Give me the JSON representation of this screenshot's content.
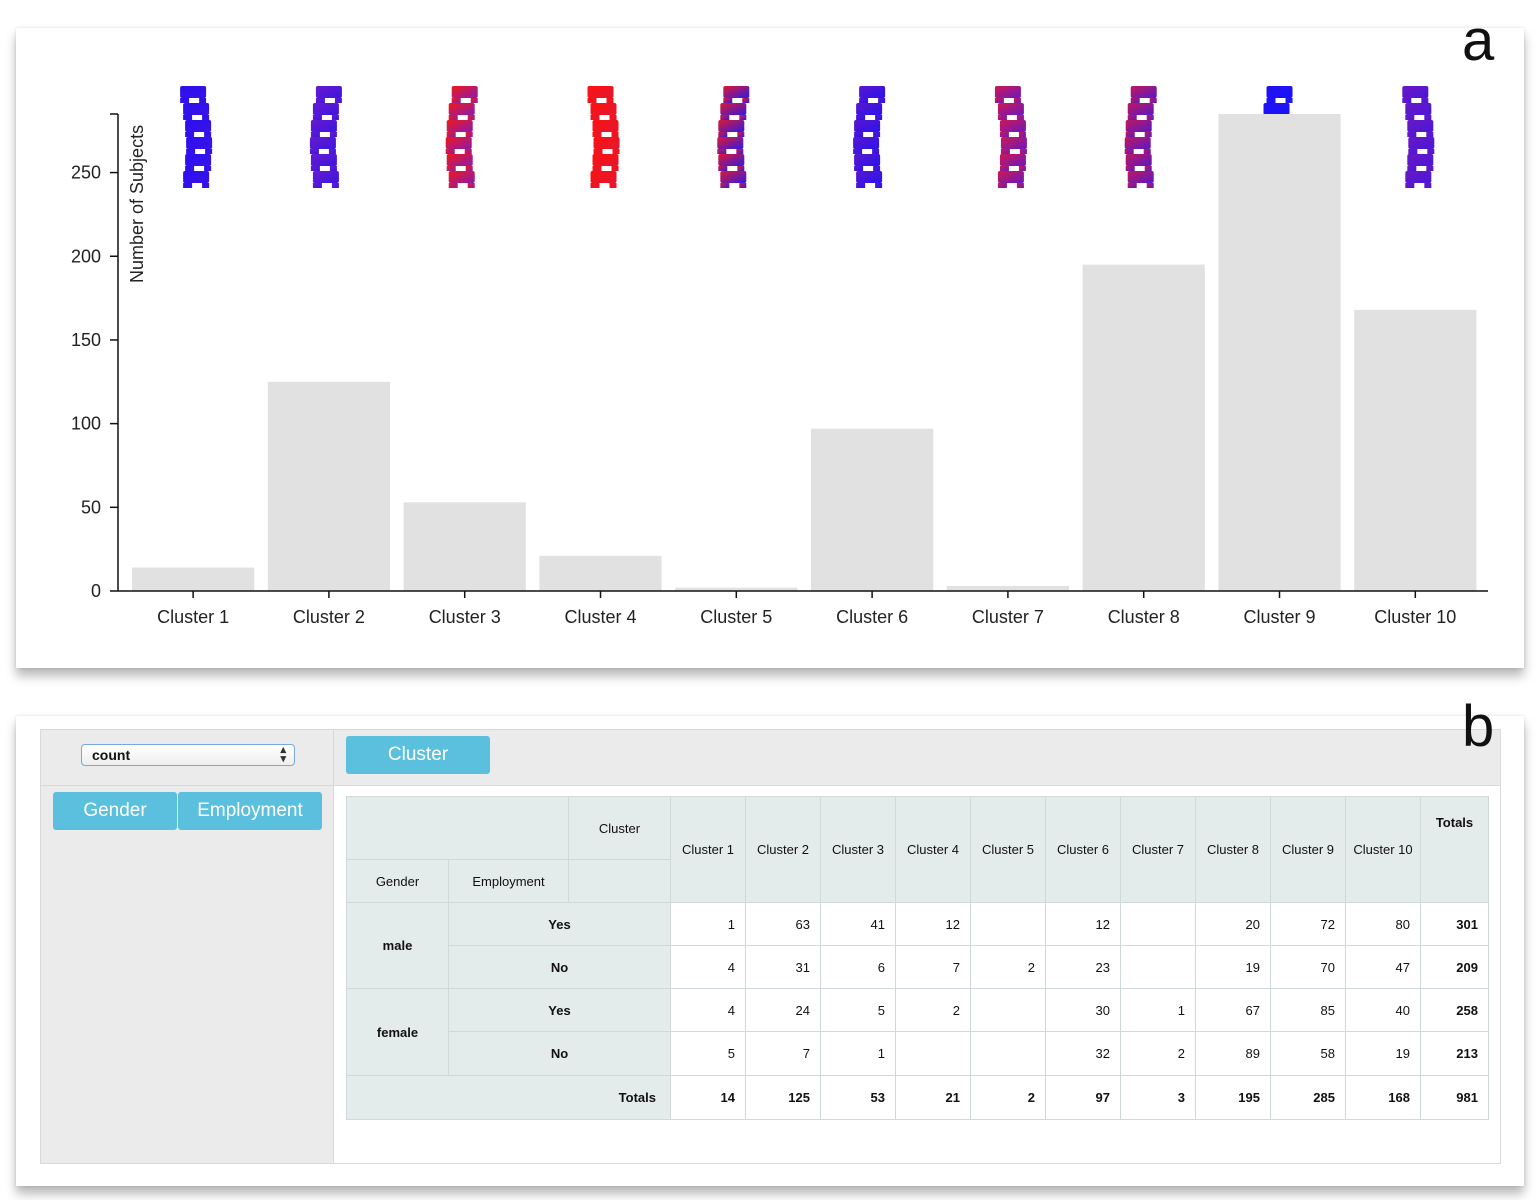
{
  "panel_a": {
    "letter": "a"
  },
  "panel_b": {
    "letter": "b"
  },
  "chart_data": {
    "type": "bar",
    "title": "",
    "xlabel": "",
    "ylabel": "Number of Subjects",
    "ylim": [
      0,
      285
    ],
    "yticks": [
      "0",
      "50",
      "100",
      "150",
      "200",
      "250"
    ],
    "categories": [
      "Cluster 1",
      "Cluster 2",
      "Cluster 3",
      "Cluster 4",
      "Cluster 5",
      "Cluster 6",
      "Cluster 7",
      "Cluster 8",
      "Cluster 9",
      "Cluster 10"
    ],
    "values": [
      14,
      125,
      53,
      21,
      2,
      97,
      3,
      195,
      285,
      168
    ],
    "bar_color": "#e1e1e1",
    "glyph_colors": [
      [
        "#2a10f0",
        "#3a12e8"
      ],
      [
        "#6a1acc",
        "#3a16e2"
      ],
      [
        "#f01818",
        "#8a1ab0"
      ],
      [
        "#ff1010",
        "#e01830"
      ],
      [
        "#e01830",
        "#3018e6"
      ],
      [
        "#5a16cc",
        "#2a14ee"
      ],
      [
        "#d01850",
        "#6a18c0"
      ],
      [
        "#c0185a",
        "#5a18c8"
      ],
      [
        "#2214f0",
        "#1a10ff"
      ],
      [
        "#6a18c4",
        "#4a16d8"
      ]
    ],
    "grid": false,
    "legend": "none"
  },
  "pivot": {
    "aggregator": "count",
    "row_fields": [
      "Gender",
      "Employment"
    ],
    "col_field": "Cluster",
    "header": {
      "col_attr_label": "Cluster",
      "row_attr_labels": [
        "Gender",
        "Employment"
      ],
      "col_labels": [
        "Cluster 1",
        "Cluster 2",
        "Cluster 3",
        "Cluster 4",
        "Cluster 5",
        "Cluster 6",
        "Cluster 7",
        "Cluster 8",
        "Cluster 9",
        "Cluster 10"
      ],
      "totals_label": "Totals"
    },
    "rows": [
      {
        "gender": "male",
        "employment": "Yes",
        "values": [
          "1",
          "63",
          "41",
          "12",
          "",
          "12",
          "",
          "20",
          "72",
          "80"
        ],
        "total": "301"
      },
      {
        "gender": "",
        "employment": "No",
        "values": [
          "4",
          "31",
          "6",
          "7",
          "2",
          "23",
          "",
          "19",
          "70",
          "47"
        ],
        "total": "209"
      },
      {
        "gender": "female",
        "employment": "Yes",
        "values": [
          "4",
          "24",
          "5",
          "2",
          "",
          "30",
          "1",
          "67",
          "85",
          "40"
        ],
        "total": "258"
      },
      {
        "gender": "",
        "employment": "No",
        "values": [
          "5",
          "7",
          "1",
          "",
          "",
          "32",
          "2",
          "89",
          "58",
          "19"
        ],
        "total": "213"
      }
    ],
    "totals_row": {
      "label": "Totals",
      "values": [
        "14",
        "125",
        "53",
        "21",
        "2",
        "97",
        "3",
        "195",
        "285",
        "168"
      ],
      "grand_total": "981"
    }
  }
}
